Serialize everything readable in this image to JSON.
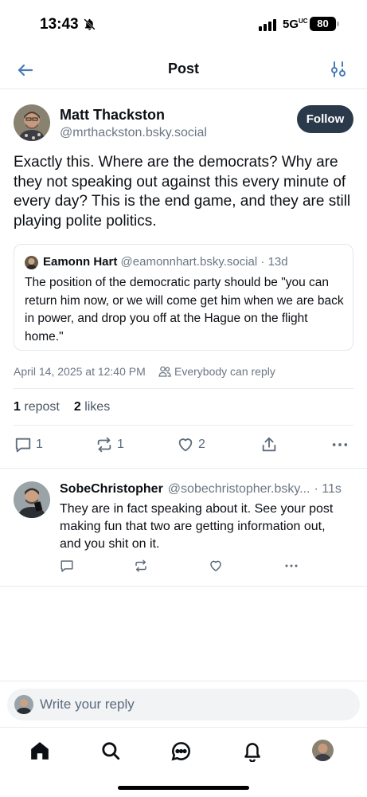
{
  "status_bar": {
    "time": "13:43",
    "network": "5G",
    "network_sup": "UC",
    "battery": "80"
  },
  "header": {
    "title": "Post",
    "back_icon": "arrow-left-icon",
    "filter_icon": "sliders-icon"
  },
  "post": {
    "author_name": "Matt Thackston",
    "author_handle": "@mrthackston.bsky.social",
    "follow_label": "Follow",
    "text": "Exactly this. Where are the democrats? Why are they not speaking out against this every minute of every day? This is the end game, and they are still playing polite politics.",
    "quote": {
      "author_name": "Eamonn Hart",
      "author_handle": "@eamonnhart.bsky.social",
      "age": "· 13d",
      "text": "The position of the democratic party should be \"you can return him now, or we will come get him when we are back in power, and drop you off at the Hague on the flight home.\""
    },
    "timestamp": "April 14, 2025 at 12:40 PM",
    "reply_setting": "Everybody can reply",
    "reposts_count": "1",
    "reposts_label": "repost",
    "likes_count": "2",
    "likes_label": "likes",
    "actions": {
      "reply_count": "1",
      "repost_count": "1",
      "like_count": "2"
    }
  },
  "reply": {
    "author_name": "SobeChristopher",
    "author_handle": "@sobechristopher.bsky...",
    "age": "· 11s",
    "text": "They are in fact speaking about it. See your post making fun that two are getting information out, and you shit on it."
  },
  "composer": {
    "placeholder": "Write your reply"
  },
  "tabs": [
    "home-icon",
    "search-icon",
    "chat-icon",
    "bell-icon",
    "profile-avatar"
  ],
  "colors": {
    "accent": "#1083fe",
    "follow_bg": "#2b3a4a",
    "muted_text": "#6b7785",
    "icon": "#5d6c7b"
  }
}
